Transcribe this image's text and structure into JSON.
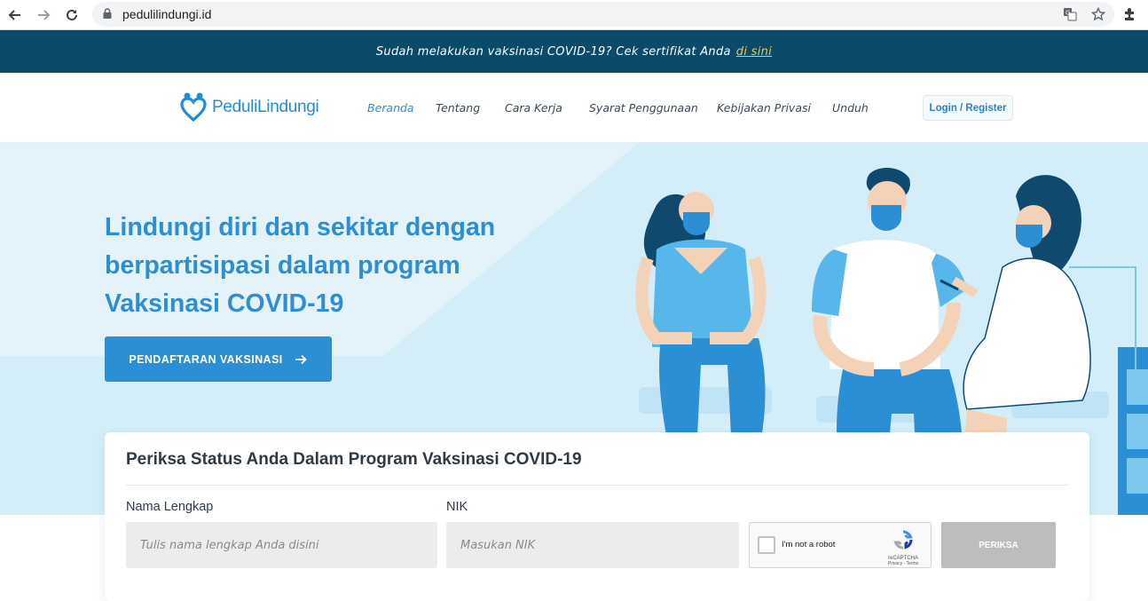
{
  "browser": {
    "url": "pedulilindungi.id",
    "back_icon": "back-arrow-icon",
    "forward_icon": "forward-arrow-icon",
    "reload_icon": "reload-icon",
    "lock_icon": "lock-icon",
    "translate_icon": "translate-icon",
    "bookmark_icon": "star-icon",
    "extensions_icon": "puzzle-icon"
  },
  "banner": {
    "text": "Sudah melakukan vaksinasi COVID-19? Cek sertifikat Anda",
    "link_text": "di sini"
  },
  "header": {
    "logo_name": "PeduliLindungi",
    "nav": [
      "Beranda",
      "Tentang",
      "Cara Kerja",
      "Syarat Penggunaan",
      "Kebijakan Privasi",
      "Unduh"
    ],
    "active_nav": "Beranda",
    "login_label": "Login / Register"
  },
  "hero": {
    "headline": "Lindungi diri dan sekitar dengan berpartisipasi dalam program Vaksinasi COVID-19",
    "cta_label": "PENDAFTARAN VAKSINASI"
  },
  "status_card": {
    "title": "Periksa Status Anda Dalam Program Vaksinasi COVID-19",
    "name_label": "Nama Lengkap",
    "name_placeholder": "Tulis nama lengkap Anda disini",
    "nik_label": "NIK",
    "nik_placeholder": "Masukan NIK",
    "recaptcha_text": "I'm not a robot",
    "recaptcha_brand": "reCAPTCHA",
    "recaptcha_links": "Privacy - Terms",
    "submit_label": "PERIKSA"
  },
  "colors": {
    "banner_bg": "#0b4a68",
    "banner_link": "#f5c542",
    "brand_blue": "#2b8fd5",
    "hero_bg": "#d3eef8",
    "submit_disabled": "#bdbdbd"
  }
}
